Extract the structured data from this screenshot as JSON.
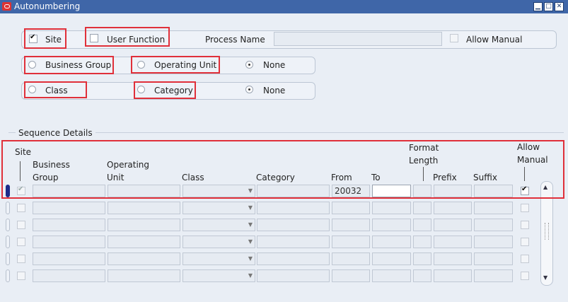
{
  "window": {
    "title": "Autonumbering",
    "minimize": "▁",
    "maximize": "□",
    "close": "✕"
  },
  "top": {
    "site_label": "Site",
    "site_checked": true,
    "user_function_label": "User Function",
    "user_function_checked": false,
    "process_name_label": "Process Name",
    "process_name_value": "",
    "allow_manual_label": "Allow Manual",
    "allow_manual_checked": false,
    "group1": {
      "business_group": "Business Group",
      "operating_unit": "Operating Unit",
      "none": "None",
      "selected": "none"
    },
    "group2": {
      "class": "Class",
      "category": "Category",
      "none": "None",
      "selected": "none"
    }
  },
  "sequence": {
    "section_label": "Sequence Details",
    "headers": {
      "site": "Site",
      "business_group_1": "Business",
      "business_group_2": "Group",
      "operating_unit_1": "Operating",
      "operating_unit_2": "Unit",
      "class": "Class",
      "category": "Category",
      "from": "From",
      "to": "To",
      "format_length_1": "Format",
      "format_length_2": "Length",
      "prefix": "Prefix",
      "suffix": "Suffix",
      "allow_manual_1": "Allow",
      "allow_manual_2": "Manual"
    },
    "rows": [
      {
        "site": true,
        "from": "20032",
        "to": "",
        "allow_manual": true
      },
      {
        "site": false,
        "from": "",
        "to": "",
        "allow_manual": false
      },
      {
        "site": false,
        "from": "",
        "to": "",
        "allow_manual": false
      },
      {
        "site": false,
        "from": "",
        "to": "",
        "allow_manual": false
      },
      {
        "site": false,
        "from": "",
        "to": "",
        "allow_manual": false
      },
      {
        "site": false,
        "from": "",
        "to": "",
        "allow_manual": false
      }
    ]
  },
  "colors": {
    "title_bar": "#3f66a8",
    "highlight": "#e0303a",
    "current_row": "#1c2b8a"
  }
}
